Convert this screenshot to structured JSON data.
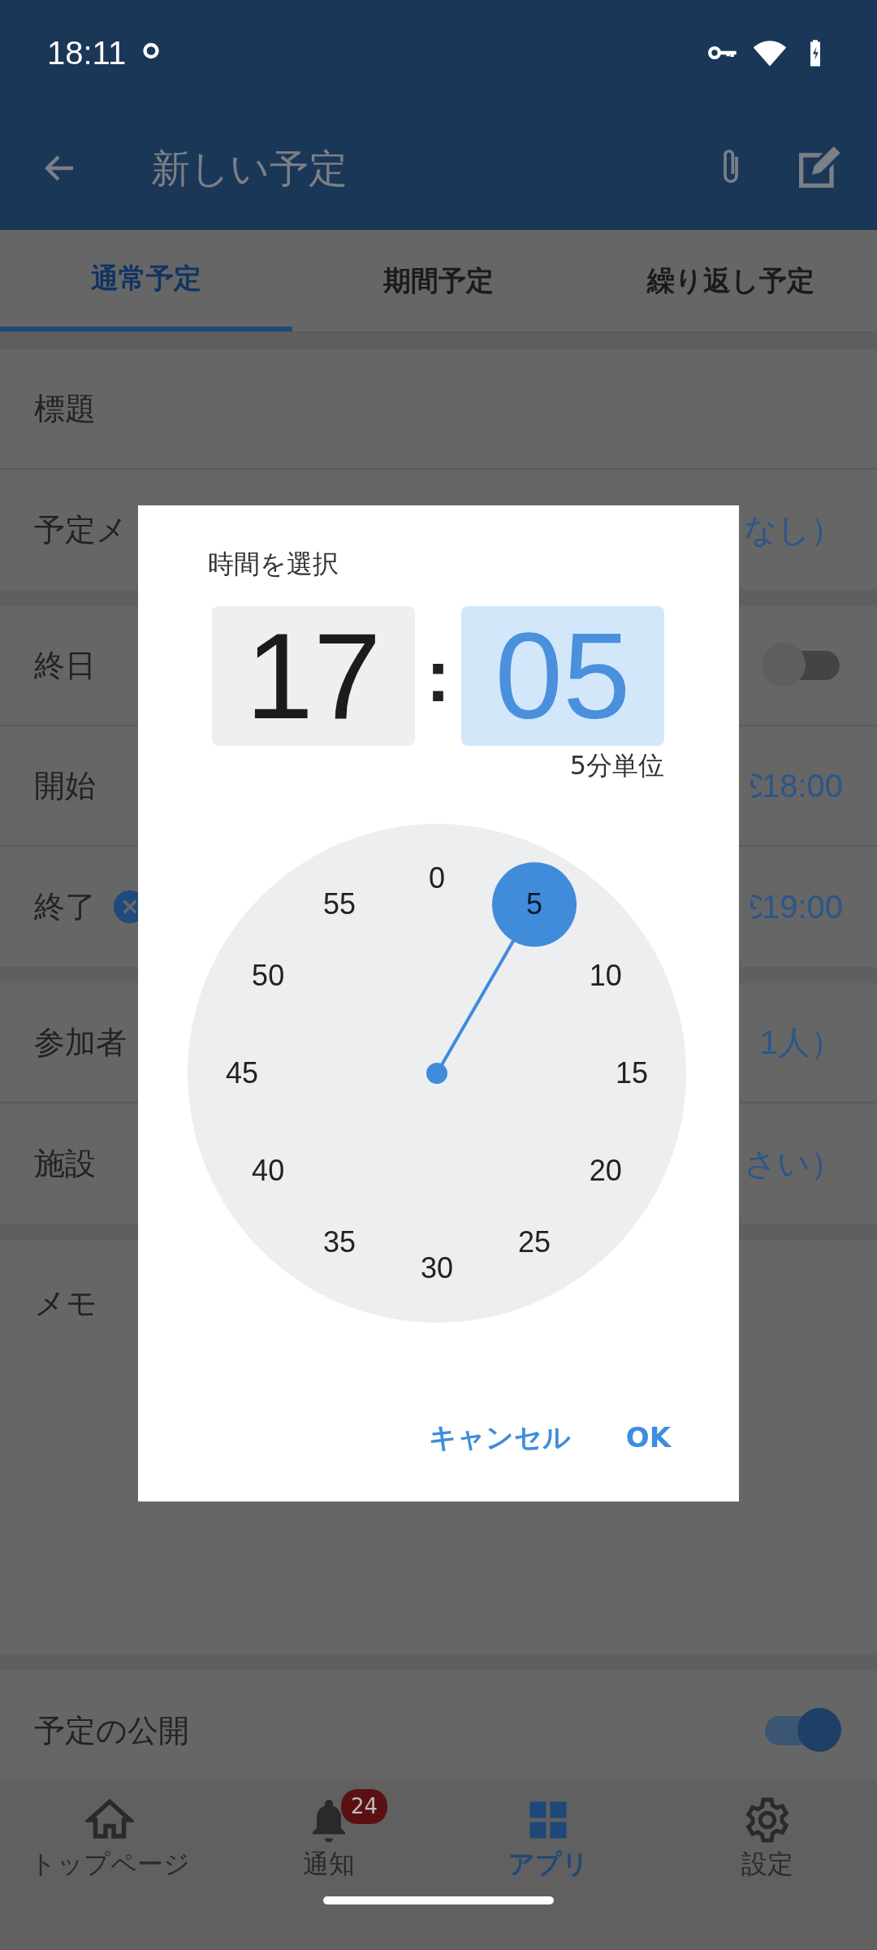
{
  "status_bar": {
    "time": "18:11"
  },
  "app_bar": {
    "title": "新しい予定"
  },
  "tabs": [
    {
      "label": "通常予定",
      "selected": true
    },
    {
      "label": "期間予定",
      "selected": false
    },
    {
      "label": "繰り返し予定",
      "selected": false
    }
  ],
  "form": {
    "sections": [
      {
        "rows": [
          {
            "kind": "text",
            "label": "標題"
          },
          {
            "kind": "value",
            "label": "予定メ",
            "value": "なし）"
          }
        ]
      },
      {
        "rows": [
          {
            "kind": "toggle",
            "label": "終日",
            "on": false
          },
          {
            "kind": "time",
            "label": "開始",
            "value": "18:00"
          },
          {
            "kind": "time",
            "label": "終了",
            "value": "19:00",
            "clear": true
          }
        ]
      },
      {
        "rows": [
          {
            "kind": "value",
            "label": "参加者",
            "value": "1人）"
          },
          {
            "kind": "value",
            "label": "施設",
            "value": "さい）"
          }
        ]
      },
      {
        "rows": [
          {
            "kind": "memo",
            "label": "メモ"
          }
        ]
      },
      {
        "rows": [
          {
            "kind": "toggle",
            "label": "予定の公開",
            "on": true
          }
        ]
      }
    ]
  },
  "bottom_nav": [
    {
      "label": "トップページ",
      "selected": false
    },
    {
      "label": "通知",
      "badge": "24",
      "selected": false
    },
    {
      "label": "アプリ",
      "selected": true
    },
    {
      "label": "設定",
      "selected": false
    }
  ],
  "time_dialog": {
    "title": "時間を選択",
    "hour": {
      "value": "17",
      "selected": false
    },
    "separator": ":",
    "minute": {
      "value": "05",
      "selected": true
    },
    "step_label": "5分単位",
    "dial": [
      {
        "label": "0",
        "selected": false
      },
      {
        "label": "5",
        "selected": true
      },
      {
        "label": "10",
        "selected": false
      },
      {
        "label": "15",
        "selected": false
      },
      {
        "label": "20",
        "selected": false
      },
      {
        "label": "25",
        "selected": false
      },
      {
        "label": "30",
        "selected": false
      },
      {
        "label": "35",
        "selected": false
      },
      {
        "label": "40",
        "selected": false
      },
      {
        "label": "45",
        "selected": false
      },
      {
        "label": "50",
        "selected": false
      },
      {
        "label": "55",
        "selected": false
      }
    ],
    "buttons": [
      "キャンセル",
      "OK"
    ]
  }
}
